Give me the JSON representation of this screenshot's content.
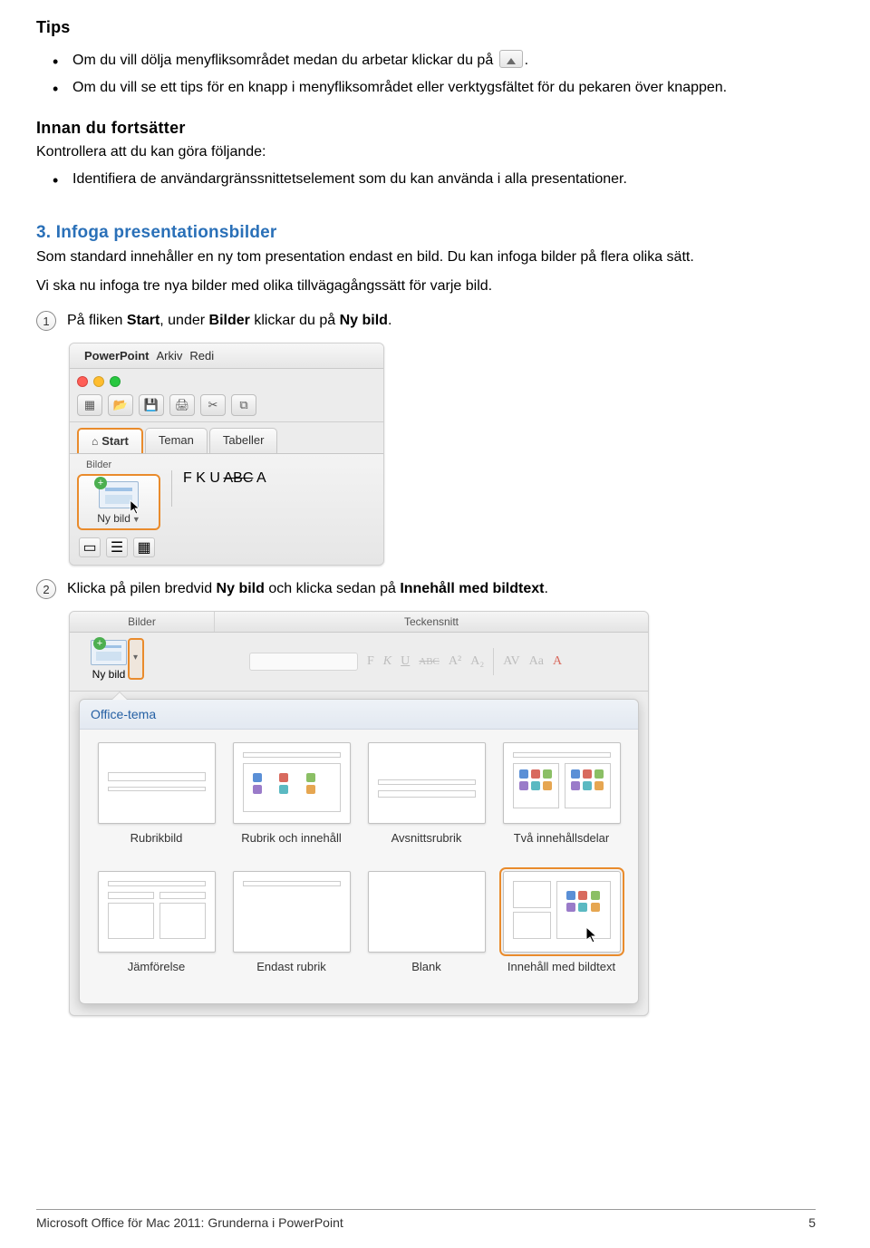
{
  "tips_heading": "Tips",
  "tips": [
    "Om du vill dölja menyfliksområdet medan du arbetar klickar du på",
    "Om du vill se ett tips för en knapp i menyfliksområdet eller verktygsfältet för du pekaren över knappen."
  ],
  "tip1_tail": ".",
  "before_heading": "Innan du fortsätter",
  "before_line": "Kontrollera att du kan göra följande:",
  "before_bullet": "Identifiera de användargränssnittetselement som du kan använda i alla presentationer.",
  "section_heading": "3. Infoga presentationsbilder",
  "section_p1": "Som standard innehåller en ny tom presentation endast en bild. Du kan infoga bilder på flera olika sätt.",
  "section_p2": "Vi ska nu infoga tre nya bilder med olika tillvägagångssätt för varje bild.",
  "step1_num": "1",
  "step1_pre": "På fliken ",
  "step1_b1": "Start",
  "step1_mid": ", under ",
  "step1_b2": "Bilder",
  "step1_mid2": " klickar du på ",
  "step1_b3": "Ny bild",
  "step1_end": ".",
  "shot1": {
    "menubar": {
      "app": "PowerPoint",
      "items": [
        "Arkiv",
        "Redi"
      ]
    },
    "tabs": [
      "Start",
      "Teman",
      "Tabeller"
    ],
    "group_label": "Bilder",
    "new_slide": "Ny bild",
    "font_tools": [
      "F",
      "K",
      "U",
      "ABC",
      "A"
    ]
  },
  "step2_num": "2",
  "step2_pre": "Klicka på pilen bredvid ",
  "step2_b1": "Ny bild",
  "step2_mid": " och klicka sedan på ",
  "step2_b2": "Innehåll med bildtext",
  "step2_end": ".",
  "shot2": {
    "head_left": "Bilder",
    "head_right": "Teckensnitt",
    "new_slide": "Ny bild",
    "font_tools": [
      "F",
      "K",
      "U",
      "ABC",
      "A²",
      "A₂",
      "AV",
      "Aa",
      "A"
    ],
    "popup_title": "Office-tema",
    "layouts": [
      "Rubrikbild",
      "Rubrik och innehåll",
      "Avsnittsrubrik",
      "Två innehållsdelar",
      "Jämförelse",
      "Endast rubrik",
      "Blank",
      "Innehåll med bildtext"
    ]
  },
  "footer_left": "Microsoft Office för Mac 2011: Grunderna i PowerPoint",
  "footer_right": "5"
}
